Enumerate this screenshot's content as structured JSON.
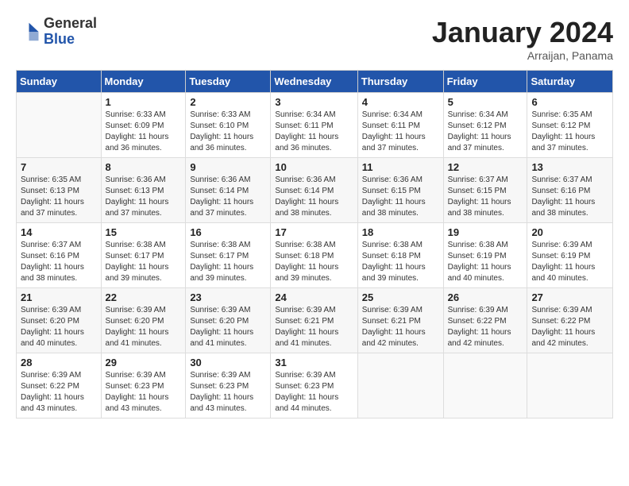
{
  "logo": {
    "general": "General",
    "blue": "Blue"
  },
  "title": "January 2024",
  "subtitle": "Arraijan, Panama",
  "days_header": [
    "Sunday",
    "Monday",
    "Tuesday",
    "Wednesday",
    "Thursday",
    "Friday",
    "Saturday"
  ],
  "weeks": [
    [
      {
        "day": "",
        "sunrise": "",
        "sunset": "",
        "daylight": ""
      },
      {
        "day": "1",
        "sunrise": "Sunrise: 6:33 AM",
        "sunset": "Sunset: 6:09 PM",
        "daylight": "Daylight: 11 hours and 36 minutes."
      },
      {
        "day": "2",
        "sunrise": "Sunrise: 6:33 AM",
        "sunset": "Sunset: 6:10 PM",
        "daylight": "Daylight: 11 hours and 36 minutes."
      },
      {
        "day": "3",
        "sunrise": "Sunrise: 6:34 AM",
        "sunset": "Sunset: 6:11 PM",
        "daylight": "Daylight: 11 hours and 36 minutes."
      },
      {
        "day": "4",
        "sunrise": "Sunrise: 6:34 AM",
        "sunset": "Sunset: 6:11 PM",
        "daylight": "Daylight: 11 hours and 37 minutes."
      },
      {
        "day": "5",
        "sunrise": "Sunrise: 6:34 AM",
        "sunset": "Sunset: 6:12 PM",
        "daylight": "Daylight: 11 hours and 37 minutes."
      },
      {
        "day": "6",
        "sunrise": "Sunrise: 6:35 AM",
        "sunset": "Sunset: 6:12 PM",
        "daylight": "Daylight: 11 hours and 37 minutes."
      }
    ],
    [
      {
        "day": "7",
        "sunrise": "Sunrise: 6:35 AM",
        "sunset": "Sunset: 6:13 PM",
        "daylight": "Daylight: 11 hours and 37 minutes."
      },
      {
        "day": "8",
        "sunrise": "Sunrise: 6:36 AM",
        "sunset": "Sunset: 6:13 PM",
        "daylight": "Daylight: 11 hours and 37 minutes."
      },
      {
        "day": "9",
        "sunrise": "Sunrise: 6:36 AM",
        "sunset": "Sunset: 6:14 PM",
        "daylight": "Daylight: 11 hours and 37 minutes."
      },
      {
        "day": "10",
        "sunrise": "Sunrise: 6:36 AM",
        "sunset": "Sunset: 6:14 PM",
        "daylight": "Daylight: 11 hours and 38 minutes."
      },
      {
        "day": "11",
        "sunrise": "Sunrise: 6:36 AM",
        "sunset": "Sunset: 6:15 PM",
        "daylight": "Daylight: 11 hours and 38 minutes."
      },
      {
        "day": "12",
        "sunrise": "Sunrise: 6:37 AM",
        "sunset": "Sunset: 6:15 PM",
        "daylight": "Daylight: 11 hours and 38 minutes."
      },
      {
        "day": "13",
        "sunrise": "Sunrise: 6:37 AM",
        "sunset": "Sunset: 6:16 PM",
        "daylight": "Daylight: 11 hours and 38 minutes."
      }
    ],
    [
      {
        "day": "14",
        "sunrise": "Sunrise: 6:37 AM",
        "sunset": "Sunset: 6:16 PM",
        "daylight": "Daylight: 11 hours and 38 minutes."
      },
      {
        "day": "15",
        "sunrise": "Sunrise: 6:38 AM",
        "sunset": "Sunset: 6:17 PM",
        "daylight": "Daylight: 11 hours and 39 minutes."
      },
      {
        "day": "16",
        "sunrise": "Sunrise: 6:38 AM",
        "sunset": "Sunset: 6:17 PM",
        "daylight": "Daylight: 11 hours and 39 minutes."
      },
      {
        "day": "17",
        "sunrise": "Sunrise: 6:38 AM",
        "sunset": "Sunset: 6:18 PM",
        "daylight": "Daylight: 11 hours and 39 minutes."
      },
      {
        "day": "18",
        "sunrise": "Sunrise: 6:38 AM",
        "sunset": "Sunset: 6:18 PM",
        "daylight": "Daylight: 11 hours and 39 minutes."
      },
      {
        "day": "19",
        "sunrise": "Sunrise: 6:38 AM",
        "sunset": "Sunset: 6:19 PM",
        "daylight": "Daylight: 11 hours and 40 minutes."
      },
      {
        "day": "20",
        "sunrise": "Sunrise: 6:39 AM",
        "sunset": "Sunset: 6:19 PM",
        "daylight": "Daylight: 11 hours and 40 minutes."
      }
    ],
    [
      {
        "day": "21",
        "sunrise": "Sunrise: 6:39 AM",
        "sunset": "Sunset: 6:20 PM",
        "daylight": "Daylight: 11 hours and 40 minutes."
      },
      {
        "day": "22",
        "sunrise": "Sunrise: 6:39 AM",
        "sunset": "Sunset: 6:20 PM",
        "daylight": "Daylight: 11 hours and 41 minutes."
      },
      {
        "day": "23",
        "sunrise": "Sunrise: 6:39 AM",
        "sunset": "Sunset: 6:20 PM",
        "daylight": "Daylight: 11 hours and 41 minutes."
      },
      {
        "day": "24",
        "sunrise": "Sunrise: 6:39 AM",
        "sunset": "Sunset: 6:21 PM",
        "daylight": "Daylight: 11 hours and 41 minutes."
      },
      {
        "day": "25",
        "sunrise": "Sunrise: 6:39 AM",
        "sunset": "Sunset: 6:21 PM",
        "daylight": "Daylight: 11 hours and 42 minutes."
      },
      {
        "day": "26",
        "sunrise": "Sunrise: 6:39 AM",
        "sunset": "Sunset: 6:22 PM",
        "daylight": "Daylight: 11 hours and 42 minutes."
      },
      {
        "day": "27",
        "sunrise": "Sunrise: 6:39 AM",
        "sunset": "Sunset: 6:22 PM",
        "daylight": "Daylight: 11 hours and 42 minutes."
      }
    ],
    [
      {
        "day": "28",
        "sunrise": "Sunrise: 6:39 AM",
        "sunset": "Sunset: 6:22 PM",
        "daylight": "Daylight: 11 hours and 43 minutes."
      },
      {
        "day": "29",
        "sunrise": "Sunrise: 6:39 AM",
        "sunset": "Sunset: 6:23 PM",
        "daylight": "Daylight: 11 hours and 43 minutes."
      },
      {
        "day": "30",
        "sunrise": "Sunrise: 6:39 AM",
        "sunset": "Sunset: 6:23 PM",
        "daylight": "Daylight: 11 hours and 43 minutes."
      },
      {
        "day": "31",
        "sunrise": "Sunrise: 6:39 AM",
        "sunset": "Sunset: 6:23 PM",
        "daylight": "Daylight: 11 hours and 44 minutes."
      },
      {
        "day": "",
        "sunrise": "",
        "sunset": "",
        "daylight": ""
      },
      {
        "day": "",
        "sunrise": "",
        "sunset": "",
        "daylight": ""
      },
      {
        "day": "",
        "sunrise": "",
        "sunset": "",
        "daylight": ""
      }
    ]
  ]
}
